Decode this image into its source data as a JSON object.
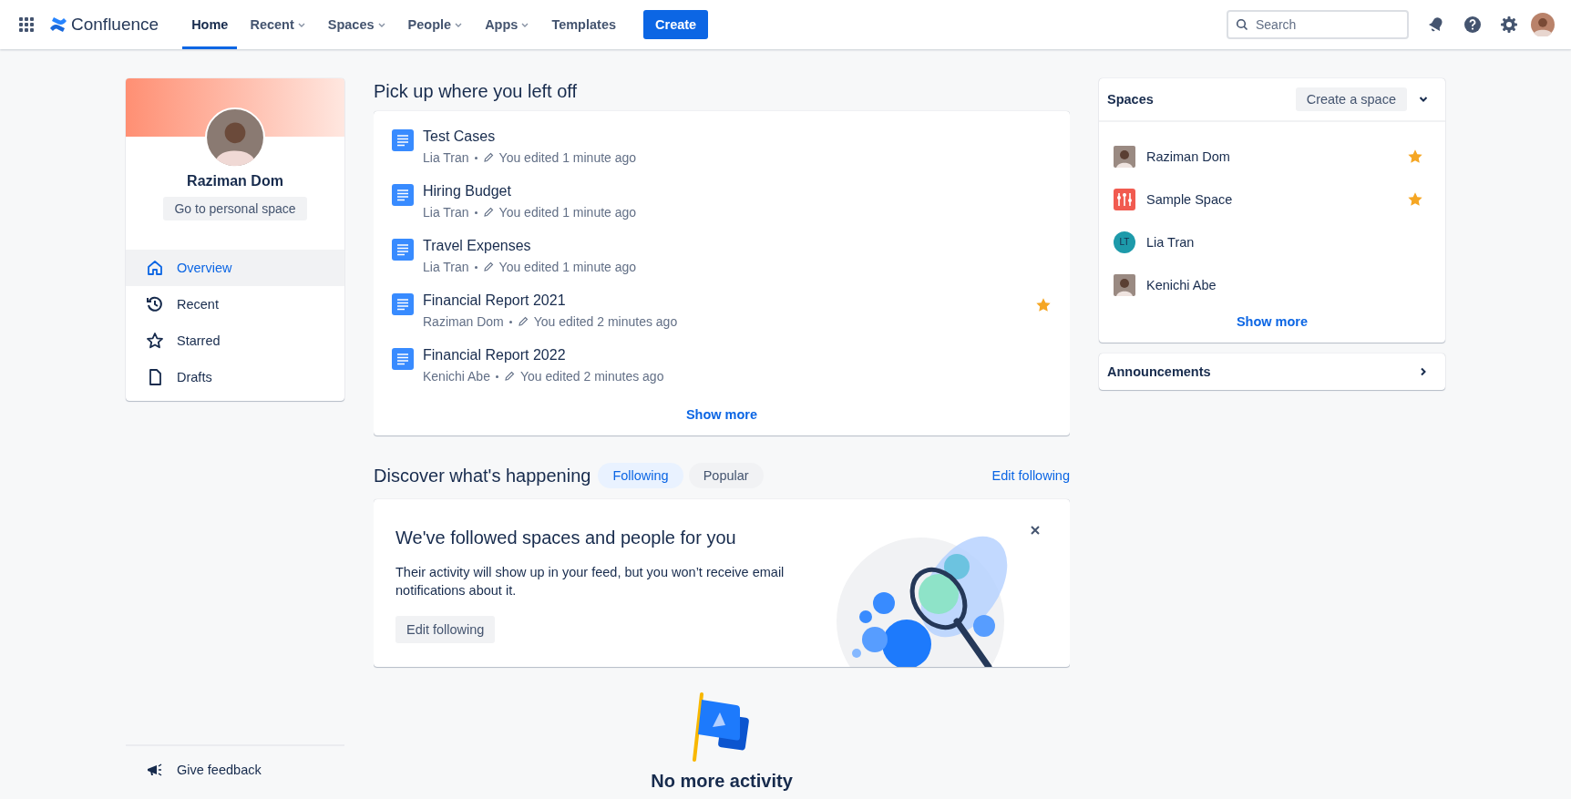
{
  "nav": {
    "logo": "Confluence",
    "items": [
      {
        "label": "Home",
        "selected": true,
        "dropdown": false
      },
      {
        "label": "Recent",
        "selected": false,
        "dropdown": true
      },
      {
        "label": "Spaces",
        "selected": false,
        "dropdown": true
      },
      {
        "label": "People",
        "selected": false,
        "dropdown": true
      },
      {
        "label": "Apps",
        "selected": false,
        "dropdown": true
      },
      {
        "label": "Templates",
        "selected": false,
        "dropdown": false
      }
    ],
    "create": "Create",
    "search": {
      "placeholder": "Search"
    }
  },
  "profile": {
    "name": "Raziman Dom",
    "button": "Go to personal space"
  },
  "sidebar": {
    "items": [
      {
        "label": "Overview",
        "kind": "home",
        "selected": true
      },
      {
        "label": "Recent",
        "kind": "history",
        "selected": false
      },
      {
        "label": "Starred",
        "kind": "star",
        "selected": false
      },
      {
        "label": "Drafts",
        "kind": "file",
        "selected": false
      }
    ],
    "feedback": "Give feedback"
  },
  "recent": {
    "title": "Pick up where you left off",
    "items": [
      {
        "title": "Test Cases",
        "owner": "Lia Tran",
        "edited": "You edited 1 minute ago",
        "starred": false
      },
      {
        "title": "Hiring Budget",
        "owner": "Lia Tran",
        "edited": "You edited 1 minute ago",
        "starred": false
      },
      {
        "title": "Travel Expenses",
        "owner": "Lia Tran",
        "edited": "You edited 1 minute ago",
        "starred": false
      },
      {
        "title": "Financial Report 2021",
        "owner": "Raziman Dom",
        "edited": "You edited 2 minutes ago",
        "starred": true
      },
      {
        "title": "Financial Report 2022",
        "owner": "Kenichi Abe",
        "edited": "You edited 2 minutes ago",
        "starred": false
      }
    ],
    "show_more": "Show more"
  },
  "discover": {
    "title": "Discover what's happening",
    "tabs": [
      {
        "label": "Following",
        "selected": true
      },
      {
        "label": "Popular",
        "selected": false
      }
    ],
    "edit_link": "Edit following",
    "card": {
      "title": "We've followed spaces and people for you",
      "text": "Their activity will show up in your feed, but you won’t receive email notifications about it.",
      "button": "Edit following"
    }
  },
  "empty": "No more activity",
  "spaces": {
    "title": "Spaces",
    "create": "Create a space",
    "items": [
      {
        "name": "Raziman Dom",
        "starred": true
      },
      {
        "name": "Sample Space",
        "kind": "app",
        "starred": true
      },
      {
        "name": "Lia Tran",
        "kind": "initials",
        "initials": "LT",
        "starred": false
      },
      {
        "name": "Kenichi Abe",
        "starred": false
      }
    ],
    "show_more": "Show more"
  },
  "announcements": "Announcements"
}
